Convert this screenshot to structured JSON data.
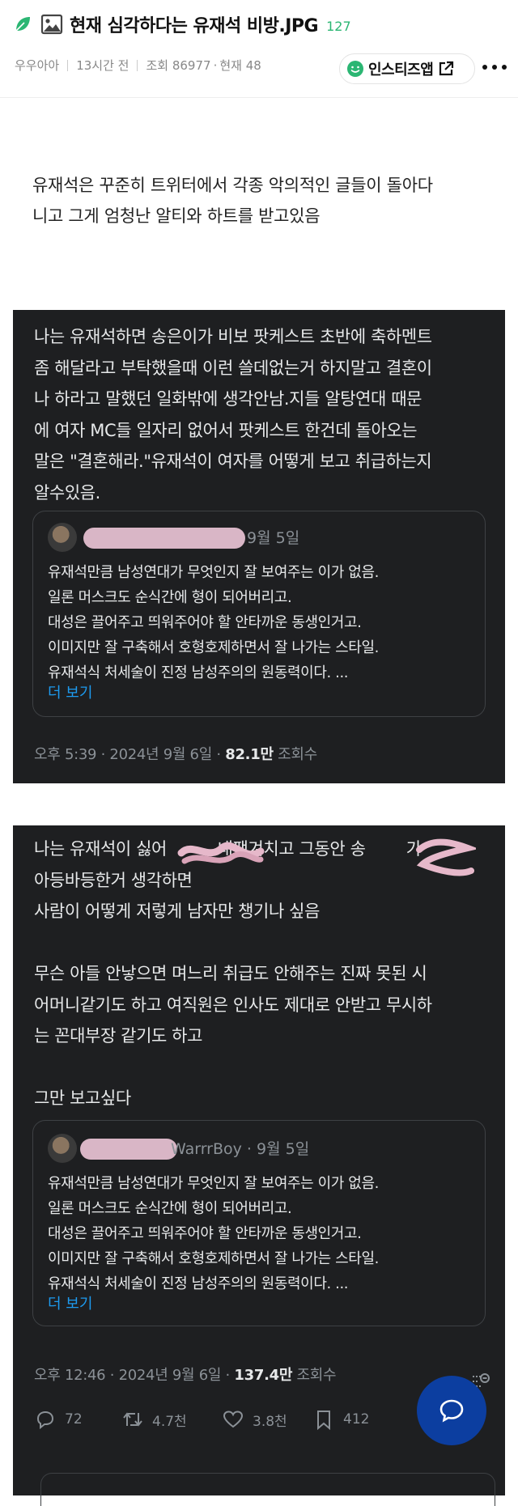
{
  "header": {
    "title": "현재 심각하다는 유재석 비방.JPG",
    "comment_count": "127",
    "author": "우우아아",
    "time_ago": "13시간 전",
    "views": "조회 86977",
    "dot": "·",
    "current": "현재 48",
    "source_label": "인스티즈앱",
    "icons": [
      "leaf-icon",
      "image-icon",
      "smile-icon",
      "external-link-icon",
      "more-icon"
    ],
    "colors": {
      "count": "#2bb673",
      "leaf": "#2bb673",
      "smile": "#2bb673"
    }
  },
  "intro": "유재석은 꾸준히 트위터에서 각종 악의적인 글들이 돌아다\n니고 그게 엄청난 알티와 하트를 받고있음",
  "tweet1": {
    "text": "나는 유재석하면 송은이가 비보 팟케스트 초반에 축하멘트\n좀 해달라고 부탁했을때 이런 쓸데없는거 하지말고 결혼이\n나 하라고 말했던 일화밖에 생각안남.지들 알탕연대 때문\n에 여자 MC들 일자리 없어서 팟케스트 한건데 돌아오는\n말은 \"결혼해라.\"유재석이 여자를 어떻게 보고 취급하는지\n알수있음.",
    "quote": {
      "date": "9월 5일",
      "body": "유재석만큼 남성연대가 무엇인지 잘 보여주는 이가 없음.\n일론 머스크도 순식간에 형이 되어버리고.\n대성은 끌어주고 띄워주어야 할 안타까운 동생인거고.\n이미지만 잘 구축해서 호형호제하면서 잘 나가는 스타일.\n유재석식 처세술이 진정 남성주의의 원동력이다. ...",
      "more": "더 보기"
    },
    "meta_time": "오후 5:39 · 2024년 9월 6일 · ",
    "meta_views": "82.1만",
    "meta_views_label": " 조회수"
  },
  "tweet2": {
    "text": "나는 유재석이 싫어          내팽겨치고 그동안 송        가\n아등바등한거 생각하면\n사람이 어떻게 저렇게 남자만 챙기나 싶음\n\n무슨 아들 안낳으면 며느리 취급도 안해주는 진짜 못된 시\n어머니같기도 하고 여직원은 인사도 제대로 안받고 무시하\n는 꼰대부장 같기도 하고\n\n그만 보고싶다",
    "quote": {
      "handle": "WarrrBoy · 9월 5일",
      "body": "유재석만큼 남성연대가 무엇인지 잘 보여주는 이가 없음.\n일론 머스크도 순식간에 형이 되어버리고.\n대성은 끌어주고 띄워주어야 할 안타까운 동생인거고.\n이미지만 잘 구축해서 호형호제하면서 잘 나가는 스타일.\n유재석식 처세술이 진정 남성주의의 원동력이다. ...",
      "more": "더 보기"
    },
    "meta_time": "오후 12:46 · 2024년 9월 6일 · ",
    "meta_views": "137.4만",
    "meta_views_label": " 조회수",
    "actions": {
      "replies": "72",
      "retweets": "4.7천",
      "likes": "3.8천",
      "bookmarks": "412"
    }
  }
}
